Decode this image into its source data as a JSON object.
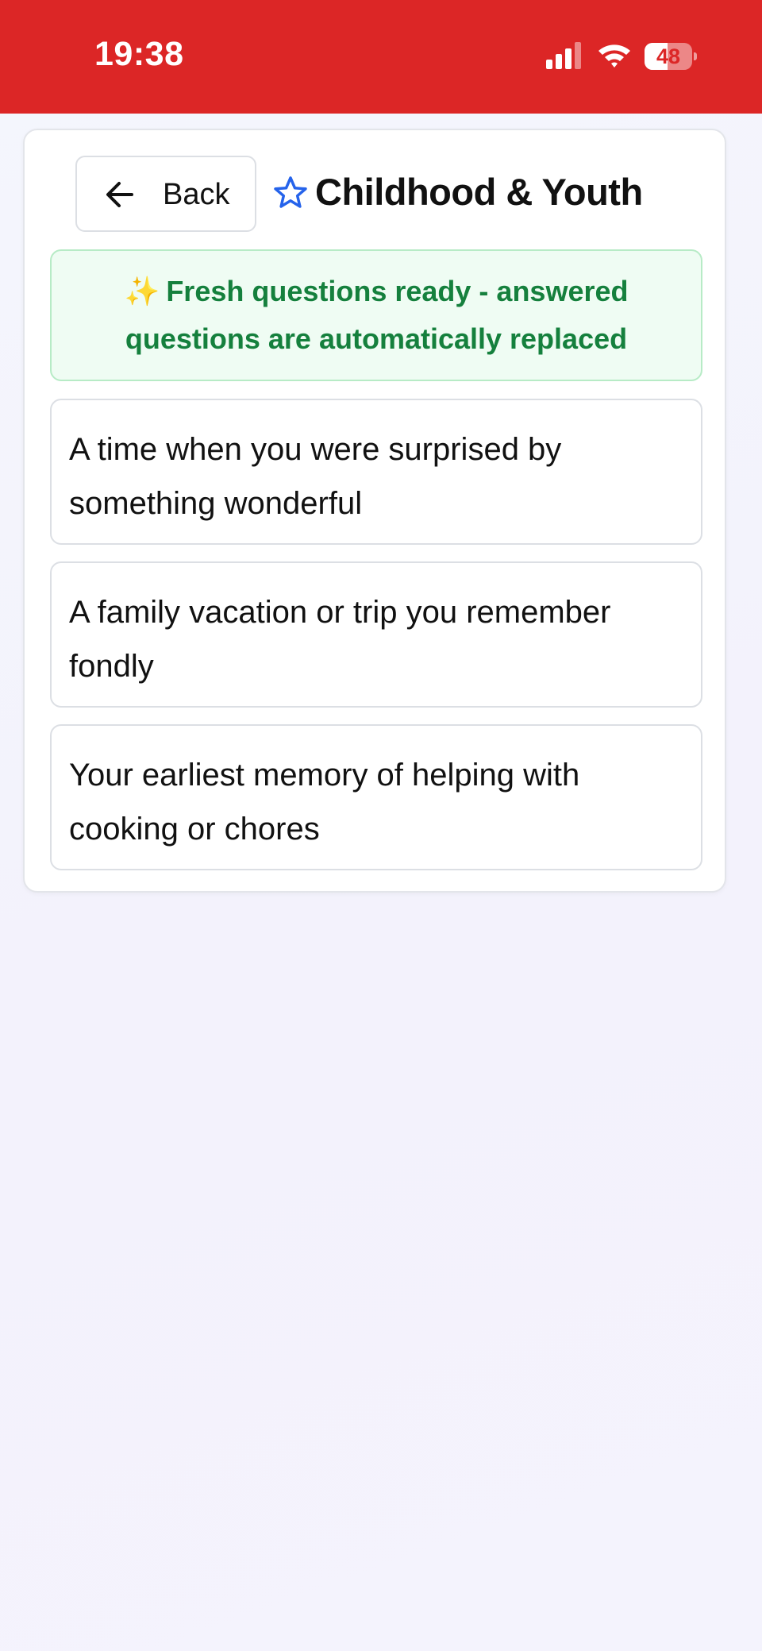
{
  "status_bar": {
    "time": "19:38",
    "battery_level": "48",
    "battery_fraction": 0.48,
    "background_color": "#dc2626",
    "icons": [
      "signal-icon",
      "wifi-icon",
      "battery-icon"
    ]
  },
  "header": {
    "back_label": "Back",
    "back_icon": "arrow-left-icon",
    "title_icon": "star-icon",
    "title": "Childhood & Youth"
  },
  "notice": {
    "icon": "sparkles-icon",
    "icon_glyph": "✨",
    "text": "Fresh questions ready - answered questions are automatically replaced"
  },
  "questions": [
    {
      "text": "A time when you were surprised by something wonderful"
    },
    {
      "text": "A family vacation or trip you remember fondly"
    },
    {
      "text": "Your earliest memory of helping with cooking or chores"
    }
  ],
  "colors": {
    "accent_red": "#dc2626",
    "success_green": "#15803d",
    "star_blue": "#2563eb"
  }
}
